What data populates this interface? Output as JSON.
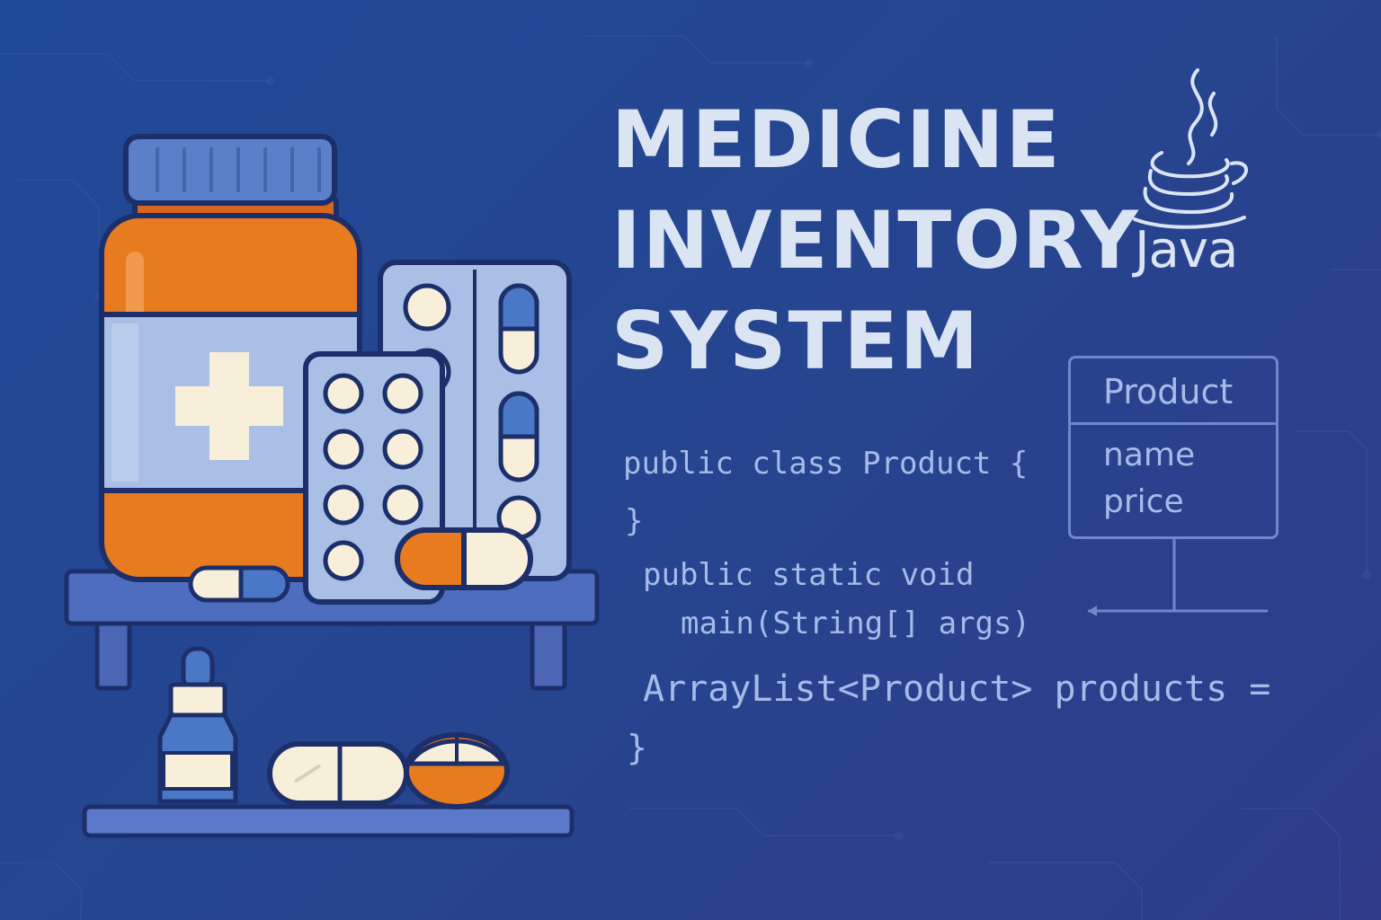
{
  "title": {
    "line1": "MEDICINE",
    "line2": "INVENTORY",
    "line3": "SYSTEM"
  },
  "logo": {
    "icon": "java-coffee-cup-icon",
    "text": "Java"
  },
  "code": {
    "line1": "public class Product {",
    "line2": "}",
    "line3": "public static void",
    "line4": "main(String[] args)",
    "line5": "ArrayList<Product> products =",
    "line6": "}"
  },
  "uml": {
    "class_name": "Product",
    "fields": [
      "name",
      "price"
    ]
  },
  "colors": {
    "background": "#2a4792",
    "title_text": "#dbe4f3",
    "code_text": "#a6bbe8",
    "bottle_orange": "#e87a1f",
    "cap_blue": "#5b7fc9",
    "label_blue": "#a9bfe6",
    "pill_cream": "#f7efd9",
    "outline": "#1d2f6b"
  },
  "illustration": {
    "items": [
      "medicine-bottle",
      "blister-pack-capsules",
      "blister-pack-tablets",
      "capsule",
      "dropper-bottle",
      "tablet-pill",
      "shelf"
    ]
  }
}
